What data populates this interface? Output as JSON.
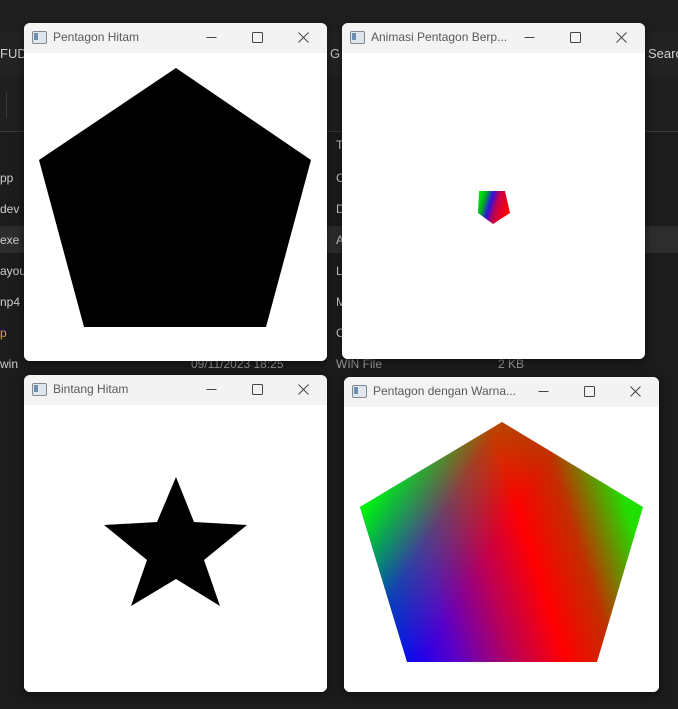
{
  "background_explorer": {
    "tab_fragment": "FUD",
    "column_fragment": "G",
    "search_fragment": "Searc",
    "type_header_fragment": "Ty",
    "file_names": [
      "pp",
      "dev",
      "exe",
      "ayou",
      "np4",
      "p",
      "win"
    ],
    "type_fragments": [
      "C",
      "D",
      "A",
      "L",
      "M",
      "C"
    ],
    "last_row": {
      "date": "09/11/2023 18:25",
      "type": "WIN File",
      "size": "2 KB"
    }
  },
  "windows": [
    {
      "title": "Pentagon Hitam",
      "shape": "black-pentagon"
    },
    {
      "title": "Animasi Pentagon Berp...",
      "shape": "small-animated-gradient-pentagon"
    },
    {
      "title": "Bintang Hitam",
      "shape": "black-star"
    },
    {
      "title": "Pentagon dengan Warna...",
      "shape": "rgb-gradient-pentagon"
    }
  ],
  "colors": {
    "shape_black": "#000000",
    "gradient_green": "#00ff00",
    "gradient_red": "#ff0000",
    "gradient_blue": "#0000ff",
    "titlebar": "#f3f3f3",
    "desktop": "#1c1c1c"
  },
  "controls": {
    "minimize_icon": "minimize-icon",
    "maximize_icon": "maximize-icon",
    "close_icon": "close-icon"
  }
}
